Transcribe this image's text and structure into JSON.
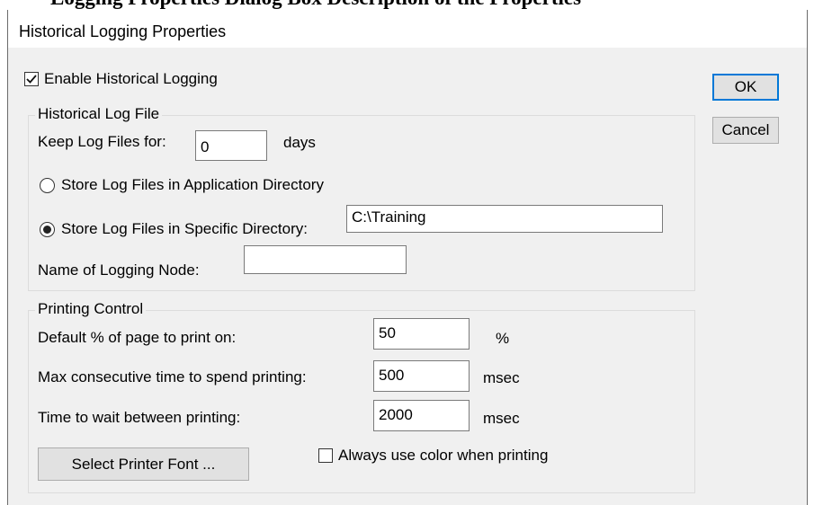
{
  "document": {
    "heading_fragment": "Logging Properties Dialog Box Description of the Properties"
  },
  "dialog": {
    "title": "Historical Logging Properties",
    "enable_logging": {
      "label": "Enable Historical Logging",
      "checked": true
    },
    "buttons": {
      "ok": "OK",
      "cancel": "Cancel"
    },
    "log_file_group": {
      "legend": "Historical Log File",
      "keep_label": "Keep Log Files for:",
      "keep_value": "0",
      "keep_unit": "days",
      "store_app_dir_label": "Store Log Files in Application Directory",
      "store_app_dir_selected": false,
      "store_specific_label": "Store Log Files in Specific Directory:",
      "store_specific_selected": true,
      "specific_dir_value": "C:\\Training",
      "node_label": "Name of Logging Node:",
      "node_value": ""
    },
    "printing_group": {
      "legend": "Printing Control",
      "default_pct_label": "Default % of page to print on:",
      "default_pct_value": "50",
      "default_pct_unit": "%",
      "max_time_label": "Max consecutive time to spend printing:",
      "max_time_value": "500",
      "max_time_unit": "msec",
      "wait_label": "Time to wait between printing:",
      "wait_value": "2000",
      "wait_unit": "msec",
      "font_button": "Select Printer Font ...",
      "always_color_label": "Always use color when printing",
      "always_color_checked": false
    }
  }
}
